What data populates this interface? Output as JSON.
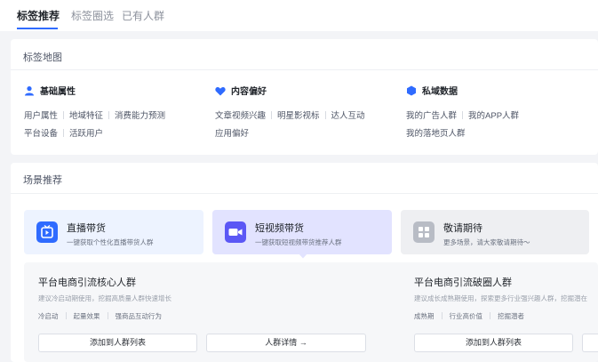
{
  "tabs": [
    {
      "label": "标签推荐"
    },
    {
      "label": "标签圈选"
    },
    {
      "label": "已有人群"
    }
  ],
  "tag_map": {
    "title": "标签地图",
    "categories": [
      {
        "name": "基础属性",
        "icon": "user-icon",
        "color": "#2f6bff",
        "rows": [
          [
            "用户属性",
            "地域特征",
            "消费能力预测"
          ],
          [
            "平台设备",
            "活跃用户"
          ]
        ]
      },
      {
        "name": "内容偏好",
        "icon": "heart-icon",
        "color": "#2f6bff",
        "rows": [
          [
            "文章视频兴趣",
            "明星影视标",
            "达人互动"
          ],
          [
            "应用偏好"
          ]
        ]
      },
      {
        "name": "私域数据",
        "icon": "hexagon-icon",
        "color": "#2f6bff",
        "rows": [
          [
            "我的广告人群",
            "我的APP人群"
          ],
          [
            "我的落地页人群"
          ]
        ]
      }
    ]
  },
  "scenes": {
    "title": "场景推荐",
    "cards": [
      {
        "title": "直播带货",
        "desc": "一键获取个性化直播带货人群",
        "icon": "live-play-icon"
      },
      {
        "title": "短视频带货",
        "desc": "一键获取短视频带货推荐人群",
        "icon": "video-camera-icon"
      },
      {
        "title": "敬请期待",
        "desc": "更多场景，请大家敬请期待～",
        "icon": "grid-icon"
      }
    ]
  },
  "audiences": [
    {
      "title": "平台电商引流核心人群",
      "desc": "建议冷启动期使用，挖掘高质量人群快速增长",
      "tags": [
        "冷启动",
        "起量效果",
        "强商品互动行为"
      ],
      "add_label": "添加到人群列表",
      "detail_label": "人群详情 →"
    },
    {
      "title": "平台电商引流破圈人群",
      "desc": "建议成长成熟期使用，探索更多行业强兴趣人群，挖掘潜在",
      "tags": [
        "成熟期",
        "行业高价值",
        "挖掘潜者"
      ],
      "add_label": "添加到人群列表",
      "detail_label": ""
    }
  ]
}
